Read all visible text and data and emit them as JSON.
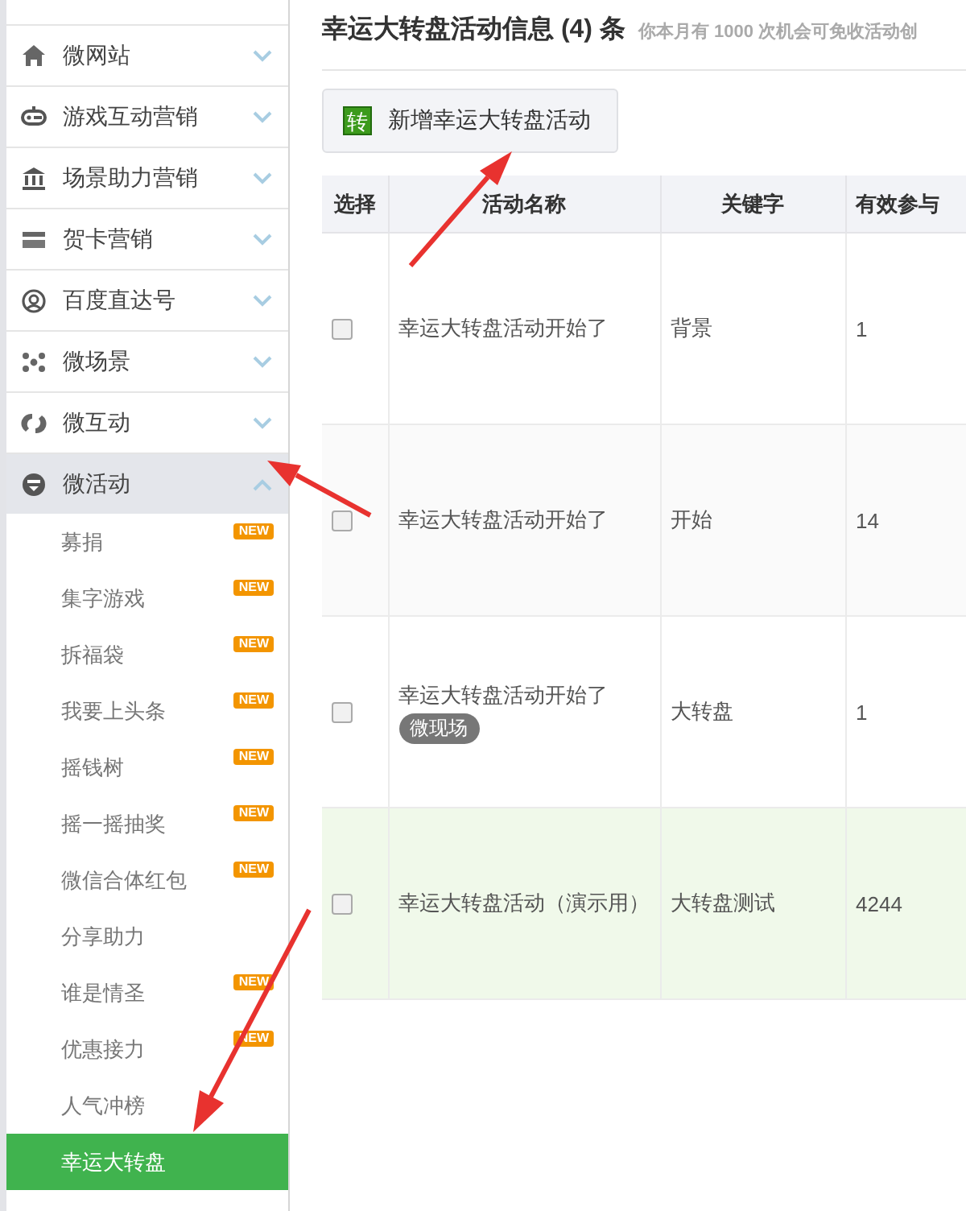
{
  "sidebar": {
    "items": [
      {
        "label": "微网站",
        "expanded": false
      },
      {
        "label": "游戏互动营销",
        "expanded": false
      },
      {
        "label": "场景助力营销",
        "expanded": false
      },
      {
        "label": "贺卡营销",
        "expanded": false
      },
      {
        "label": "百度直达号",
        "expanded": false
      },
      {
        "label": "微场景",
        "expanded": false
      },
      {
        "label": "微互动",
        "expanded": false
      },
      {
        "label": "微活动",
        "expanded": true,
        "children": [
          {
            "label": "募捐",
            "badge": "NEW",
            "selected": false
          },
          {
            "label": "集字游戏",
            "badge": "NEW",
            "selected": false
          },
          {
            "label": "拆福袋",
            "badge": "NEW",
            "selected": false
          },
          {
            "label": "我要上头条",
            "badge": "NEW",
            "selected": false
          },
          {
            "label": "摇钱树",
            "badge": "NEW",
            "selected": false
          },
          {
            "label": "摇一摇抽奖",
            "badge": "NEW",
            "selected": false
          },
          {
            "label": "微信合体红包",
            "badge": "NEW",
            "selected": false
          },
          {
            "label": "分享助力",
            "selected": false
          },
          {
            "label": "谁是情圣",
            "badge": "NEW",
            "selected": false
          },
          {
            "label": "优惠接力",
            "badge": "NEW",
            "selected": false
          },
          {
            "label": "人气冲榜",
            "selected": false
          },
          {
            "label": "幸运大转盘",
            "selected": true
          }
        ]
      }
    ]
  },
  "header": {
    "title": "幸运大转盘活动信息 (4) 条",
    "hint": "你本月有 1000 次机会可免收活动创"
  },
  "add_button": {
    "icon_char": "转",
    "label": "新增幸运大转盘活动"
  },
  "table": {
    "columns": [
      "选择",
      "活动名称",
      "关键字",
      "有效参与"
    ],
    "rows": [
      {
        "checked": false,
        "name": "幸运大转盘活动开始了",
        "keyword": "背景",
        "count": "1",
        "highlighted": false
      },
      {
        "checked": false,
        "name": "幸运大转盘活动开始了",
        "keyword": "开始",
        "count": "14",
        "highlighted": false
      },
      {
        "checked": false,
        "name": "幸运大转盘活动开始了",
        "tag": "微现场",
        "keyword": "大转盘",
        "count": "1",
        "highlighted": false
      },
      {
        "checked": false,
        "name": "幸运大转盘活动（演示用）",
        "keyword": "大转盘测试",
        "count": "4244",
        "highlighted": true
      }
    ]
  }
}
